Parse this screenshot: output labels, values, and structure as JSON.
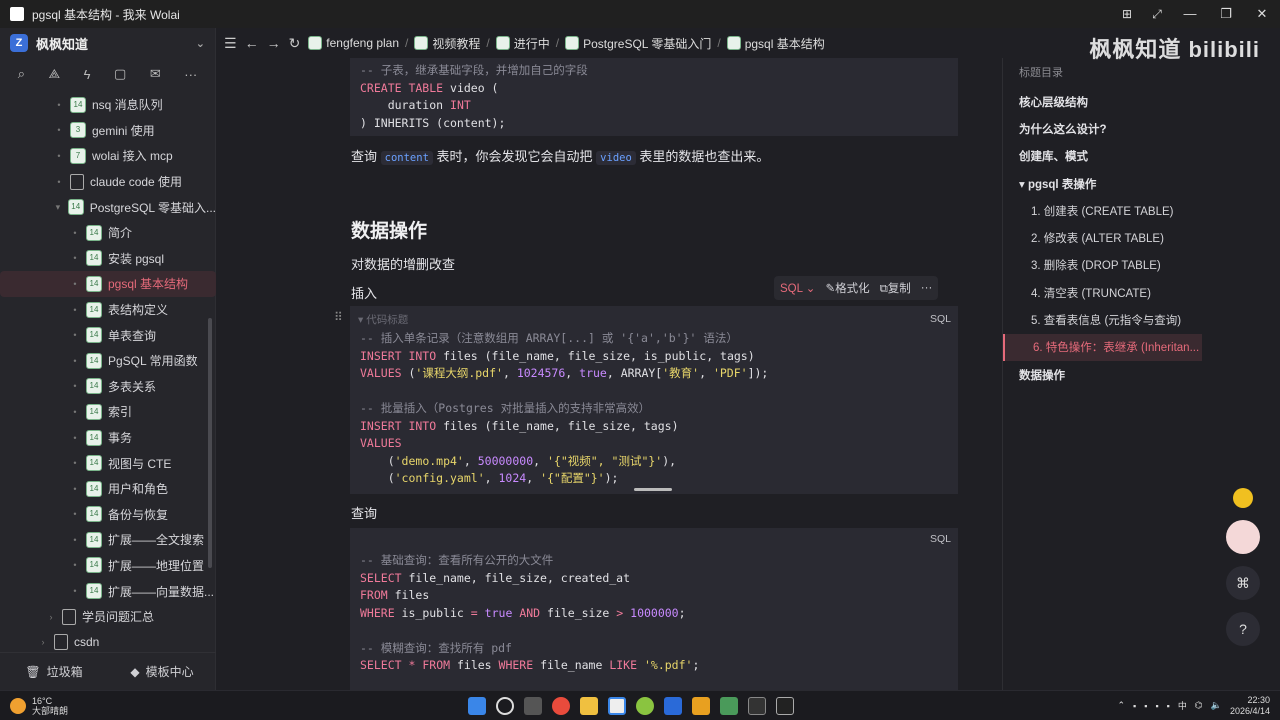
{
  "window": {
    "title": "pgsql 基本结构 - 我来 Wolai"
  },
  "workspace": {
    "name": "枫枫知道"
  },
  "sidebar": {
    "items": [
      {
        "label": "nsq 消息队列",
        "icon": "14",
        "indent": 1,
        "bullet": "•"
      },
      {
        "label": "gemini 使用",
        "icon": "3",
        "indent": 1,
        "bullet": "•"
      },
      {
        "label": "wolai 接入 mcp",
        "icon": "7",
        "indent": 1,
        "bullet": "•"
      },
      {
        "label": "claude code 使用",
        "icon": "doc",
        "indent": 1,
        "bullet": "•"
      },
      {
        "label": "PostgreSQL 零基础入...",
        "icon": "14",
        "indent": 1,
        "bullet": "▾"
      },
      {
        "label": "简介",
        "icon": "14",
        "indent": 2,
        "bullet": "•"
      },
      {
        "label": "安装 pgsql",
        "icon": "14",
        "indent": 2,
        "bullet": "•"
      },
      {
        "label": "pgsql 基本结构",
        "icon": "14",
        "indent": 2,
        "bullet": "•",
        "active": true
      },
      {
        "label": "表结构定义",
        "icon": "14",
        "indent": 2,
        "bullet": "•"
      },
      {
        "label": "单表查询",
        "icon": "14",
        "indent": 2,
        "bullet": "•"
      },
      {
        "label": "PgSQL 常用函数",
        "icon": "14",
        "indent": 2,
        "bullet": "•"
      },
      {
        "label": "多表关系",
        "icon": "14",
        "indent": 2,
        "bullet": "•"
      },
      {
        "label": "索引",
        "icon": "14",
        "indent": 2,
        "bullet": "•"
      },
      {
        "label": "事务",
        "icon": "14",
        "indent": 2,
        "bullet": "•"
      },
      {
        "label": "视图与 CTE",
        "icon": "14",
        "indent": 2,
        "bullet": "•"
      },
      {
        "label": "用户和角色",
        "icon": "14",
        "indent": 2,
        "bullet": "•"
      },
      {
        "label": "备份与恢复",
        "icon": "14",
        "indent": 2,
        "bullet": "•"
      },
      {
        "label": "扩展——全文搜索",
        "icon": "14",
        "indent": 2,
        "bullet": "•"
      },
      {
        "label": "扩展——地理位置",
        "icon": "14",
        "indent": 2,
        "bullet": "•"
      },
      {
        "label": "扩展——向量数据...",
        "icon": "14",
        "indent": 2,
        "bullet": "•"
      },
      {
        "label": "学员问题汇总",
        "icon": "doc",
        "indent": 0.5,
        "bullet": "›"
      },
      {
        "label": "csdn",
        "icon": "doc",
        "indent": 0,
        "bullet": "›"
      }
    ],
    "trash_label": "垃圾箱",
    "template_label": "模板中心"
  },
  "breadcrumb": [
    {
      "label": "fengfeng plan"
    },
    {
      "label": "视频教程"
    },
    {
      "label": "进行中"
    },
    {
      "label": "PostgreSQL 零基础入门"
    },
    {
      "label": "pgsql 基本结构"
    }
  ],
  "watermark": "枫枫知道 bilibili",
  "content": {
    "para1_pre": "查询",
    "para1_code1": "content",
    "para1_mid": "表时，你会发现它会自动把",
    "para1_code2": "video",
    "para1_post": "表里的数据也查出来。",
    "heading": "数据操作",
    "para2": "对数据的增删改查",
    "insert_label": "插入",
    "query_label": "查询",
    "code_title_placeholder": "代码标题",
    "code_lang": "SQL",
    "codebar": {
      "lang": "SQL",
      "format": "格式化",
      "copy": "复制",
      "more": "···"
    }
  },
  "toc": {
    "header": "标题目录",
    "items": [
      {
        "label": "核心层级结构",
        "level": 1
      },
      {
        "label": "为什么这么设计?",
        "level": 1
      },
      {
        "label": "创建库、模式",
        "level": 1
      },
      {
        "label": "▾ pgsql 表操作",
        "level": 1
      },
      {
        "label": "1. 创建表 (CREATE TABLE)",
        "level": 2
      },
      {
        "label": "2. 修改表 (ALTER TABLE)",
        "level": 2
      },
      {
        "label": "3. 删除表 (DROP TABLE)",
        "level": 2
      },
      {
        "label": "4. 清空表 (TRUNCATE)",
        "level": 2
      },
      {
        "label": "5. 查看表信息 (元指令与查询)",
        "level": 2
      },
      {
        "label": "6. 特色操作：表继承 (Inheritan...",
        "level": 2,
        "active": true
      },
      {
        "label": "数据操作",
        "level": 1
      }
    ]
  },
  "taskbar": {
    "temp": "16°C",
    "weather": "大部晴朗",
    "time": "22:30",
    "date": "2026/4/14",
    "ime": "中"
  },
  "colors": {
    "accent": "#e56a7a",
    "bg": "#1f1f24",
    "code_bg": "#2a2a32"
  }
}
